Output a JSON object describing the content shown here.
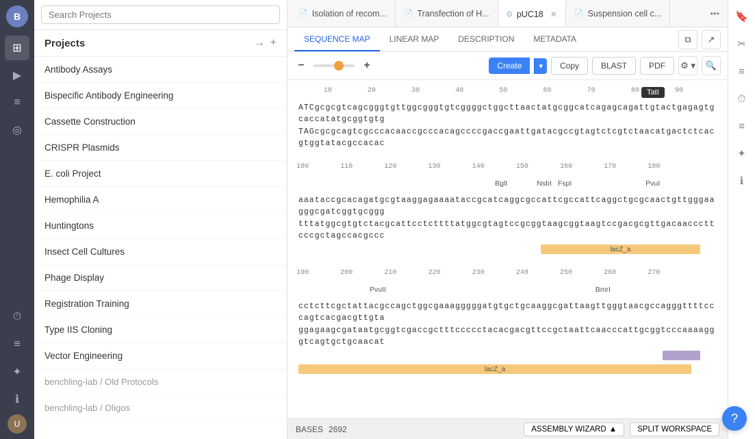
{
  "rail": {
    "avatar_initial": "B",
    "bottom_avatar_initial": "U",
    "icons": [
      "⊞",
      "▶",
      "≡",
      "◎",
      "⏱",
      "≡",
      "✦",
      "ℹ"
    ]
  },
  "sidebar": {
    "search_placeholder": "Search Projects",
    "title": "Projects",
    "projects": [
      {
        "label": "Antibody Assays",
        "secondary": false
      },
      {
        "label": "Bispecific Antibody Engineering",
        "secondary": false
      },
      {
        "label": "Cassette Construction",
        "secondary": false
      },
      {
        "label": "CRISPR Plasmids",
        "secondary": false
      },
      {
        "label": "E. coli Project",
        "secondary": false
      },
      {
        "label": "Hemophilia A",
        "secondary": false
      },
      {
        "label": "Huntingtons",
        "secondary": false
      },
      {
        "label": "Insect Cell Cultures",
        "secondary": false
      },
      {
        "label": "Phage Display",
        "secondary": false
      },
      {
        "label": "Registration Training",
        "secondary": false
      },
      {
        "label": "Type IIS Cloning",
        "secondary": false
      },
      {
        "label": "Vector Engineering",
        "secondary": false
      },
      {
        "label": "benchling-lab / Old Protocols",
        "secondary": true
      },
      {
        "label": "benchling-lab / Oligos",
        "secondary": true
      }
    ]
  },
  "tabs": [
    {
      "id": "tab1",
      "label": "Isolation of recom...",
      "icon": "📄",
      "active": false,
      "closeable": false
    },
    {
      "id": "tab2",
      "label": "Transfection of H...",
      "icon": "📄",
      "active": false,
      "closeable": false
    },
    {
      "id": "tab3",
      "label": "pUC18",
      "icon": "⊙",
      "active": true,
      "closeable": true
    },
    {
      "id": "tab4",
      "label": "Suspension cell c...",
      "icon": "📄",
      "active": false,
      "closeable": false
    }
  ],
  "sub_tabs": {
    "items": [
      {
        "label": "SEQUENCE MAP",
        "active": true
      },
      {
        "label": "LINEAR MAP",
        "active": false
      },
      {
        "label": "DESCRIPTION",
        "active": false
      },
      {
        "label": "METADATA",
        "active": false
      }
    ]
  },
  "toolbar": {
    "zoom_minus": "−",
    "zoom_plus": "+",
    "create_label": "Create",
    "copy_label": "Copy",
    "blast_label": "BLAST",
    "pdf_label": "PDF"
  },
  "sequence": {
    "blocks": [
      {
        "id": "block1",
        "rulers": [
          {
            "pos": "10",
            "left": "6.5%"
          },
          {
            "pos": "20",
            "left": "17%"
          },
          {
            "pos": "30",
            "left": "27.5%"
          },
          {
            "pos": "40",
            "left": "38%"
          },
          {
            "pos": "50",
            "left": "48.5%"
          },
          {
            "pos": "60",
            "left": "59%"
          },
          {
            "pos": "70",
            "left": "69.5%"
          },
          {
            "pos": "80",
            "left": "80%"
          },
          {
            "pos": "90",
            "left": "90.5%"
          }
        ],
        "enzyme_tooltip": "TatI",
        "enzyme_tooltip_pos": "85%",
        "seq_lines": [
          "ATCgcgcgtcagcgggtgttggcgggtgtcggggctggcttaactatgcggcatcagagcagattgtactgagagtgcaccatatgcggtgtg",
          "TAGcgcgcagtcgcccacaaccgcccacagccccgaccgaattgatacgccgtagtctcgtctaacatgactctcacgtggtatacgccacac"
        ]
      },
      {
        "id": "block2",
        "rulers": [
          {
            "pos": "100",
            "left": "0%"
          },
          {
            "pos": "110",
            "left": "10.5%"
          },
          {
            "pos": "120",
            "left": "21%"
          },
          {
            "pos": "130",
            "left": "31.5%"
          },
          {
            "pos": "140",
            "left": "42%"
          },
          {
            "pos": "150",
            "left": "52.5%"
          },
          {
            "pos": "160",
            "left": "63%"
          },
          {
            "pos": "170",
            "left": "73.5%"
          },
          {
            "pos": "180",
            "left": "84%"
          }
        ],
        "enzymes": [
          {
            "label": "BglI",
            "left": "48%"
          },
          {
            "label": "NsbI",
            "left": "58.5%"
          },
          {
            "label": "FspI",
            "left": "63%"
          },
          {
            "label": "PvuI",
            "left": "85%"
          }
        ],
        "seq_lines": [
          "aaataccgcacagatgcgtaaggagaaaataccgcatcaggcgccattcgccattcaggctgcgcaactgttgggaagggcgatcggtgcggg",
          "tttatggcgtgtctacgcattcctcttttatggcgtagtccgcggtaagcggtaagtccgacgcgttgacaacccttcccgctagccacgccc"
        ],
        "features": [
          {
            "label": "lacZ_a",
            "left": "58%",
            "width": "37%",
            "type": "lacz"
          }
        ]
      },
      {
        "id": "block3",
        "rulers": [
          {
            "pos": "190",
            "left": "0%"
          },
          {
            "pos": "200",
            "left": "10.5%"
          },
          {
            "pos": "210",
            "left": "21%"
          },
          {
            "pos": "220",
            "left": "31.5%"
          },
          {
            "pos": "230",
            "left": "42%"
          },
          {
            "pos": "240",
            "left": "52.5%"
          },
          {
            "pos": "250",
            "left": "63%"
          },
          {
            "pos": "260",
            "left": "73.5%"
          },
          {
            "pos": "270",
            "left": "84%"
          }
        ],
        "enzymes": [
          {
            "label": "PvuII",
            "left": "17%"
          },
          {
            "label": "BmrI",
            "left": "72%"
          }
        ],
        "seq_lines": [
          "cctcttcgctattacgccagctggcgaaagggggatgtgctgcaaggcgattaagttgggtaacgccagggttttcccagtcacgacgttgta",
          "ggagaagcgataatgcggtcgaccgctttccccctacacgacgttccgctaattcaacccattgcggtcccaaaagggtcagtgctgcaacat"
        ],
        "features": [
          {
            "label": "",
            "left": "87%",
            "width": "8%",
            "type": "purple"
          },
          {
            "label": "lacZ_a",
            "left": "0%",
            "width": "94%",
            "type": "lacz"
          }
        ]
      }
    ],
    "bases": "2692"
  },
  "bottom_bar": {
    "bases_label": "BASES",
    "bases_value": "2692",
    "assembly_label": "ASSEMBLY WIZARD",
    "split_label": "SPLIT WORKSPACE"
  }
}
